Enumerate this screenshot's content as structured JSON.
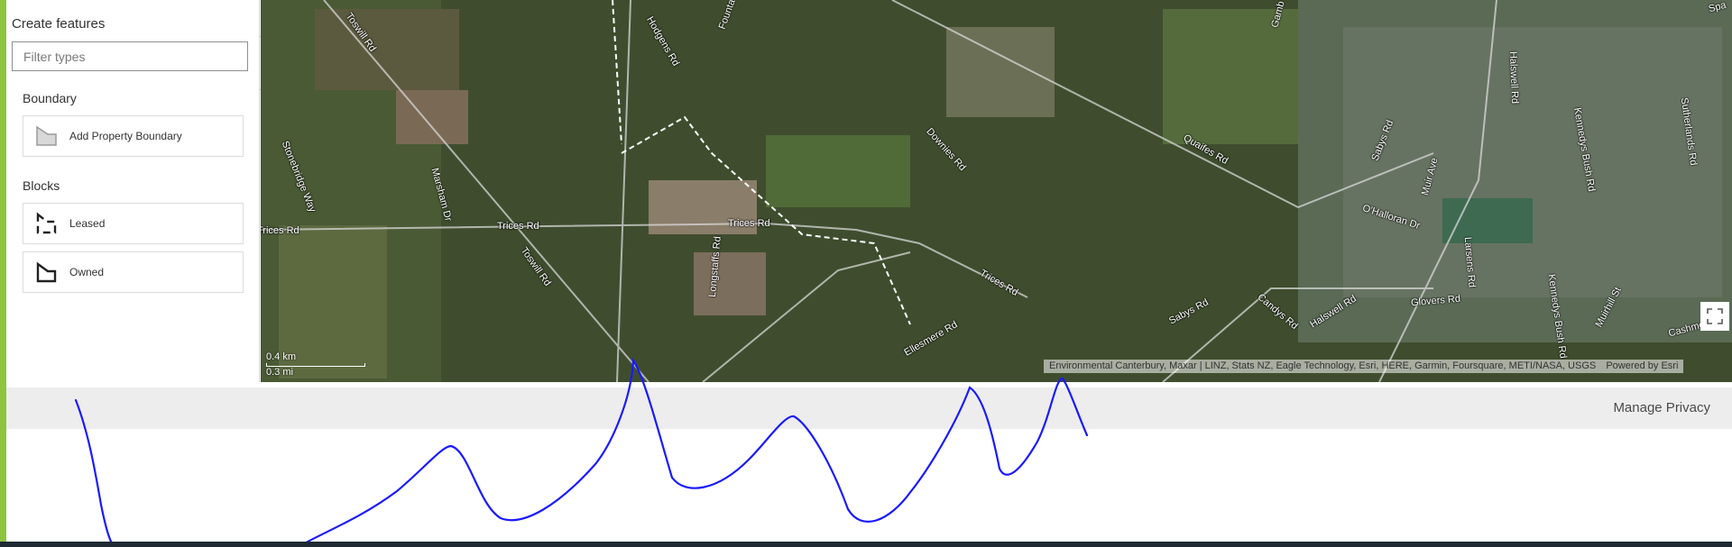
{
  "panel": {
    "title": "Create features",
    "filter_placeholder": "Filter types",
    "groups": [
      {
        "title": "Boundary",
        "items": [
          {
            "label": "Add Property Boundary",
            "icon": "polygon-icon"
          }
        ]
      },
      {
        "title": "Blocks",
        "items": [
          {
            "label": "Leased",
            "icon": "dashed-polygon-icon"
          },
          {
            "label": "Owned",
            "icon": "polygon-outline-icon"
          }
        ]
      }
    ]
  },
  "map": {
    "road_labels": [
      "Toswill Rd",
      "Hodgens Rd",
      "Founta",
      "Downies Rd",
      "Quaifes Rd",
      "Sabys Rd",
      "Halswell Rd",
      "Kennedys Bush Rd",
      "Sutherlands Rd",
      "O'Halloran Dr",
      "Muir Ave",
      "Larsens Rd",
      "Stonebridge Way",
      "Marsham Dr",
      "Trices Rd",
      "Trices Rd",
      "Trices Rd",
      "Trices Rd",
      "Toswill Rd",
      "Longstaffs Rd",
      "Ellesmere Rd",
      "Sabys Rd",
      "Candys Rd",
      "Halswell Rd",
      "Glovers Rd",
      "Kennedys Bush Rd",
      "Muirhill St",
      "Cashmere",
      "Spa",
      "Gamb"
    ],
    "scale_km": "0.4 km",
    "scale_mi": "0.3 mi",
    "attribution": "Environmental Canterbury, Maxar | LINZ, Stats NZ, Eagle Technology, Esri, HERE, Garmin, Foursquare, METI/NASA, USGS",
    "powered_by": "Powered by Esri"
  },
  "footer": {
    "privacy_label": "Manage Privacy"
  },
  "colors": {
    "rail": "#8ec33f",
    "annotation": "#1a1aff"
  }
}
